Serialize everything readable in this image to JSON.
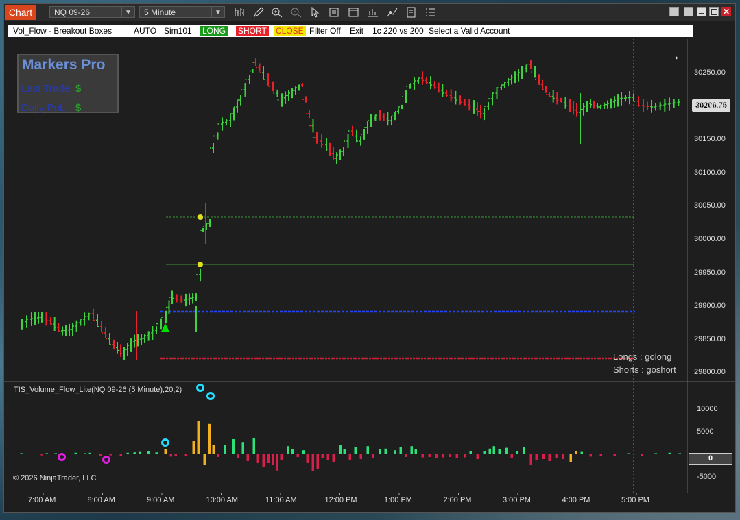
{
  "toolbar": {
    "chart_tab": "Chart",
    "instrument": "NQ 09-26",
    "interval": "5 Minute",
    "tools": [
      "bar-type-icon",
      "draw-pencil-icon",
      "zoom-in-icon",
      "zoom-out-icon",
      "pointer-icon",
      "data-box-icon",
      "properties-icon",
      "indicators-icon",
      "strategies-icon",
      "templates-icon",
      "menu-icon"
    ]
  },
  "strategy_bar": {
    "name": "Vol_Flow - Breakout Boxes",
    "mode": "AUTO",
    "account": "Sim101",
    "long_label": "LONG",
    "short_label": "SHORT",
    "close_label": "CLOSE",
    "filter": "Filter Off",
    "exit": "Exit",
    "contracts": "1c 220 vs 200",
    "account_prompt": "Select a Valid Account"
  },
  "markers_panel": {
    "title": "Markers Pro",
    "last_trade_label": "Last Trade",
    "last_trade_value": "$",
    "daily_pnl_label": "Daily PnL",
    "daily_pnl_value": "$"
  },
  "price_panel": {
    "current_price": "30206.75",
    "y_ticks": [
      "30250.00",
      "30200.00",
      "30150.00",
      "30100.00",
      "30050.00",
      "30000.00",
      "29950.00",
      "29900.00",
      "29850.00",
      "29800.00"
    ],
    "annotation_longs": "Longs : golong",
    "annotation_shorts": "Shorts : goshort"
  },
  "indicator_panel": {
    "title": "TIS_Volume_Flow_Lite(NQ 09-26 (5 Minute),20,2)",
    "y_ticks": [
      "10000",
      "5000",
      "-5000"
    ],
    "zero_label": "0",
    "copyright": "© 2026 NinjaTrader, LLC"
  },
  "x_axis": {
    "ticks": [
      "7:00 AM",
      "8:00 AM",
      "9:00 AM",
      "10:00 AM",
      "11:00 AM",
      "12:00 PM",
      "1:00 PM",
      "2:00 PM",
      "3:00 PM",
      "4:00 PM",
      "5:00 PM"
    ]
  },
  "colors": {
    "up": "#3fd13f",
    "down": "#e8222a",
    "target_lines": "#3a9a3a",
    "entry_line": "#2244ff",
    "stop_line": "#cc2233",
    "vol_up": "#2ee07a",
    "vol_down": "#d81e4a",
    "vol_spike": "#f0b020"
  }
}
